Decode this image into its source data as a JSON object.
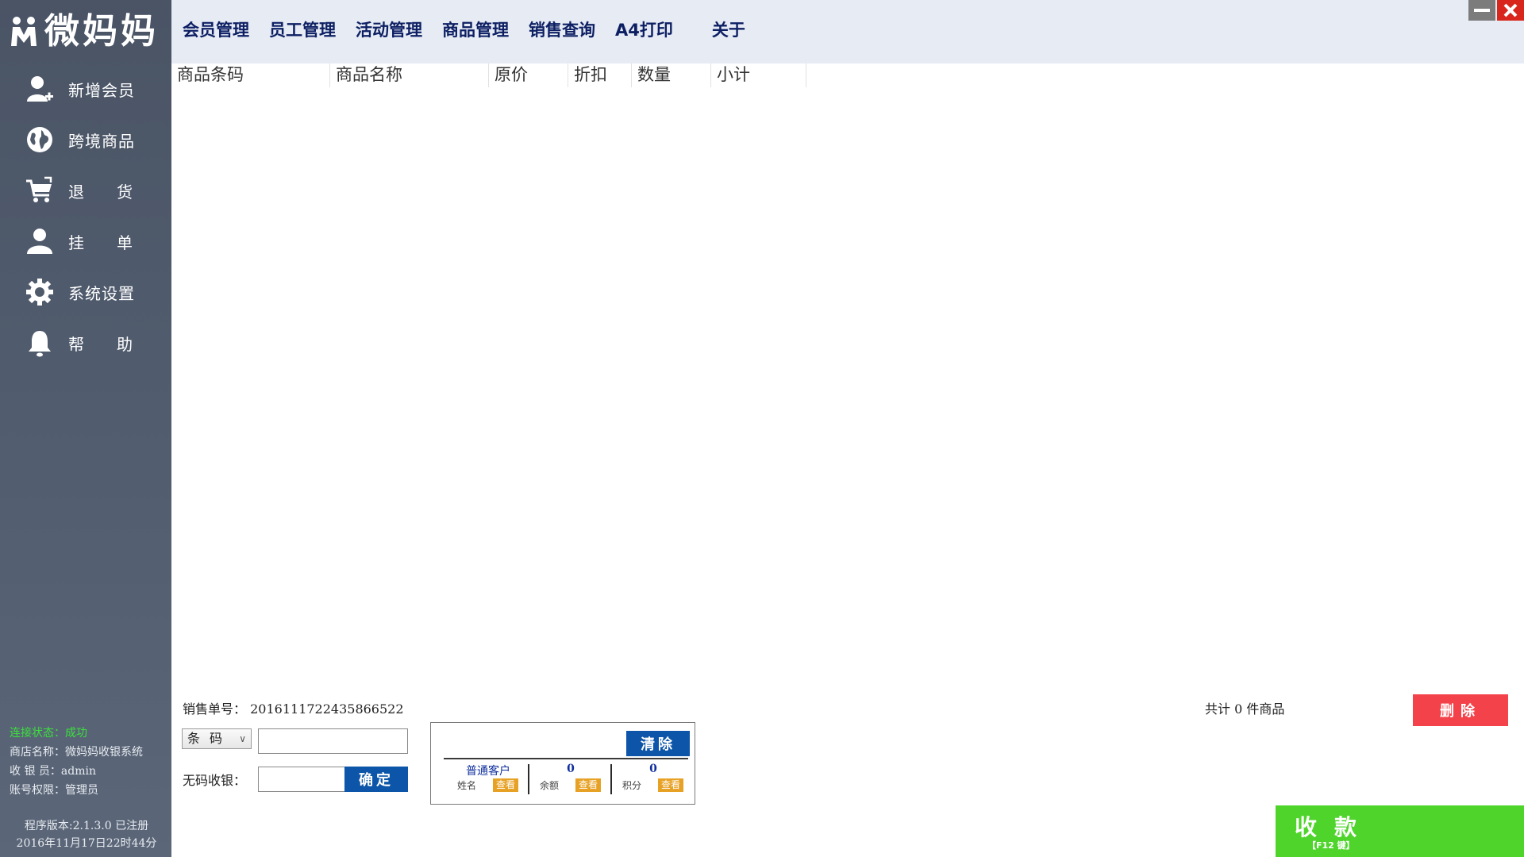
{
  "app": {
    "logo_text": "微妈妈"
  },
  "sidebar": {
    "items": [
      {
        "label": "新增会员",
        "icon": "add-user-icon"
      },
      {
        "label": "跨境商品",
        "icon": "globe-icon"
      },
      {
        "label_a": "退",
        "label_b": "货",
        "icon": "cart-icon"
      },
      {
        "label_a": "挂",
        "label_b": "单",
        "icon": "user-icon"
      },
      {
        "label": "系统设置",
        "icon": "gear-icon"
      },
      {
        "label_a": "帮",
        "label_b": "助",
        "icon": "bell-icon"
      }
    ],
    "status": {
      "connection_label": "连接状态：",
      "connection_value": "成功",
      "shop": "商店名称：微妈妈收银系统",
      "cashier": "收 银 员：admin",
      "role": "账号权限：管理员"
    },
    "version_line": "程序版本:2.1.3.0  已注册",
    "datetime_line": "2016年11月17日22时44分"
  },
  "menu": {
    "items": [
      "会员管理",
      "员工管理",
      "活动管理",
      "商品管理",
      "销售查询",
      "A4打印"
    ],
    "about": "关于"
  },
  "table": {
    "columns": [
      "商品条码",
      "商品名称",
      "原价",
      "折扣",
      "数量",
      "小计"
    ]
  },
  "bottom": {
    "order_label": "销售单号：",
    "order_number": "2016111722435866522",
    "total_text": "共计 0 件商品",
    "select_value": "条码",
    "no_code_label": "无码收银：",
    "confirm_label": "确定",
    "clear_label": "清除",
    "delete_label": "删除",
    "pay_label": "收款",
    "pay_hint": "【F12 键】"
  },
  "member": {
    "name_value": "普通客户",
    "name_key": "姓名",
    "balance_value": "0",
    "balance_key": "余额",
    "points_value": "0",
    "points_key": "积分",
    "view_label": "查看"
  }
}
